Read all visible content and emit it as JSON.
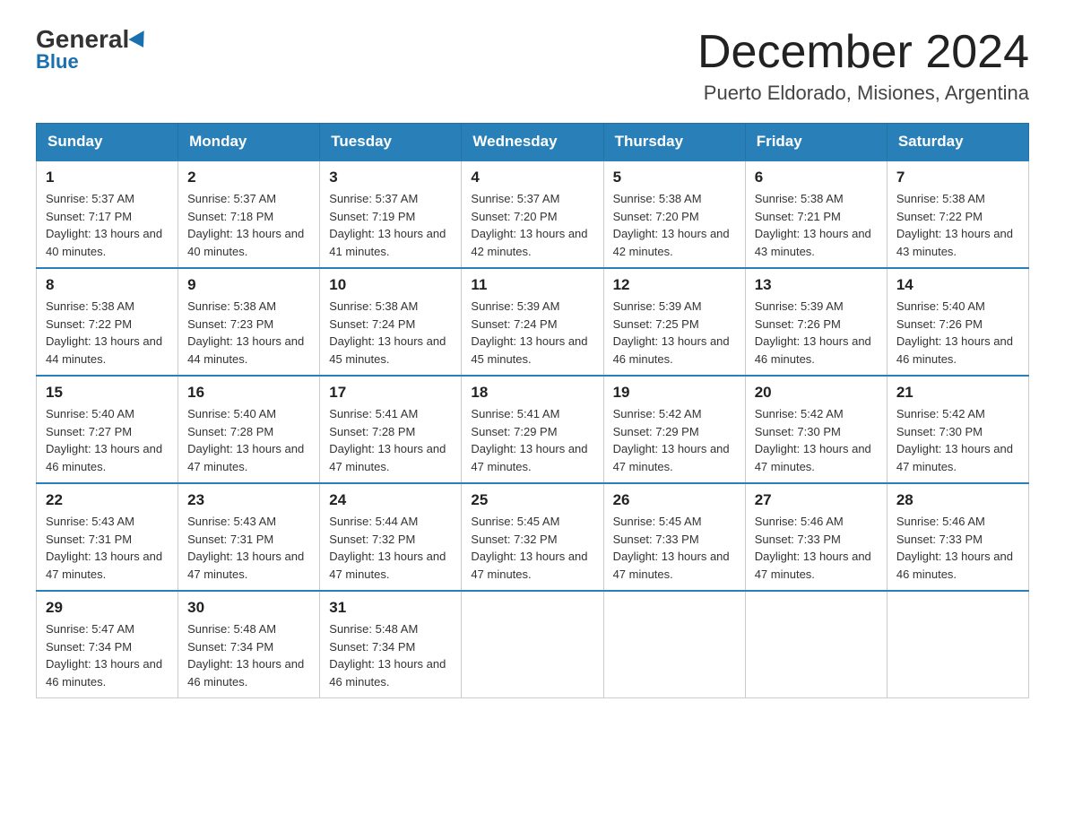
{
  "header": {
    "logo_line1": "General",
    "logo_line2": "Blue",
    "month_title": "December 2024",
    "location": "Puerto Eldorado, Misiones, Argentina"
  },
  "days_of_week": [
    "Sunday",
    "Monday",
    "Tuesday",
    "Wednesday",
    "Thursday",
    "Friday",
    "Saturday"
  ],
  "weeks": [
    [
      {
        "day": "1",
        "sunrise": "5:37 AM",
        "sunset": "7:17 PM",
        "daylight": "13 hours and 40 minutes."
      },
      {
        "day": "2",
        "sunrise": "5:37 AM",
        "sunset": "7:18 PM",
        "daylight": "13 hours and 40 minutes."
      },
      {
        "day": "3",
        "sunrise": "5:37 AM",
        "sunset": "7:19 PM",
        "daylight": "13 hours and 41 minutes."
      },
      {
        "day": "4",
        "sunrise": "5:37 AM",
        "sunset": "7:20 PM",
        "daylight": "13 hours and 42 minutes."
      },
      {
        "day": "5",
        "sunrise": "5:38 AM",
        "sunset": "7:20 PM",
        "daylight": "13 hours and 42 minutes."
      },
      {
        "day": "6",
        "sunrise": "5:38 AM",
        "sunset": "7:21 PM",
        "daylight": "13 hours and 43 minutes."
      },
      {
        "day": "7",
        "sunrise": "5:38 AM",
        "sunset": "7:22 PM",
        "daylight": "13 hours and 43 minutes."
      }
    ],
    [
      {
        "day": "8",
        "sunrise": "5:38 AM",
        "sunset": "7:22 PM",
        "daylight": "13 hours and 44 minutes."
      },
      {
        "day": "9",
        "sunrise": "5:38 AM",
        "sunset": "7:23 PM",
        "daylight": "13 hours and 44 minutes."
      },
      {
        "day": "10",
        "sunrise": "5:38 AM",
        "sunset": "7:24 PM",
        "daylight": "13 hours and 45 minutes."
      },
      {
        "day": "11",
        "sunrise": "5:39 AM",
        "sunset": "7:24 PM",
        "daylight": "13 hours and 45 minutes."
      },
      {
        "day": "12",
        "sunrise": "5:39 AM",
        "sunset": "7:25 PM",
        "daylight": "13 hours and 46 minutes."
      },
      {
        "day": "13",
        "sunrise": "5:39 AM",
        "sunset": "7:26 PM",
        "daylight": "13 hours and 46 minutes."
      },
      {
        "day": "14",
        "sunrise": "5:40 AM",
        "sunset": "7:26 PM",
        "daylight": "13 hours and 46 minutes."
      }
    ],
    [
      {
        "day": "15",
        "sunrise": "5:40 AM",
        "sunset": "7:27 PM",
        "daylight": "13 hours and 46 minutes."
      },
      {
        "day": "16",
        "sunrise": "5:40 AM",
        "sunset": "7:28 PM",
        "daylight": "13 hours and 47 minutes."
      },
      {
        "day": "17",
        "sunrise": "5:41 AM",
        "sunset": "7:28 PM",
        "daylight": "13 hours and 47 minutes."
      },
      {
        "day": "18",
        "sunrise": "5:41 AM",
        "sunset": "7:29 PM",
        "daylight": "13 hours and 47 minutes."
      },
      {
        "day": "19",
        "sunrise": "5:42 AM",
        "sunset": "7:29 PM",
        "daylight": "13 hours and 47 minutes."
      },
      {
        "day": "20",
        "sunrise": "5:42 AM",
        "sunset": "7:30 PM",
        "daylight": "13 hours and 47 minutes."
      },
      {
        "day": "21",
        "sunrise": "5:42 AM",
        "sunset": "7:30 PM",
        "daylight": "13 hours and 47 minutes."
      }
    ],
    [
      {
        "day": "22",
        "sunrise": "5:43 AM",
        "sunset": "7:31 PM",
        "daylight": "13 hours and 47 minutes."
      },
      {
        "day": "23",
        "sunrise": "5:43 AM",
        "sunset": "7:31 PM",
        "daylight": "13 hours and 47 minutes."
      },
      {
        "day": "24",
        "sunrise": "5:44 AM",
        "sunset": "7:32 PM",
        "daylight": "13 hours and 47 minutes."
      },
      {
        "day": "25",
        "sunrise": "5:45 AM",
        "sunset": "7:32 PM",
        "daylight": "13 hours and 47 minutes."
      },
      {
        "day": "26",
        "sunrise": "5:45 AM",
        "sunset": "7:33 PM",
        "daylight": "13 hours and 47 minutes."
      },
      {
        "day": "27",
        "sunrise": "5:46 AM",
        "sunset": "7:33 PM",
        "daylight": "13 hours and 47 minutes."
      },
      {
        "day": "28",
        "sunrise": "5:46 AM",
        "sunset": "7:33 PM",
        "daylight": "13 hours and 46 minutes."
      }
    ],
    [
      {
        "day": "29",
        "sunrise": "5:47 AM",
        "sunset": "7:34 PM",
        "daylight": "13 hours and 46 minutes."
      },
      {
        "day": "30",
        "sunrise": "5:48 AM",
        "sunset": "7:34 PM",
        "daylight": "13 hours and 46 minutes."
      },
      {
        "day": "31",
        "sunrise": "5:48 AM",
        "sunset": "7:34 PM",
        "daylight": "13 hours and 46 minutes."
      },
      null,
      null,
      null,
      null
    ]
  ]
}
